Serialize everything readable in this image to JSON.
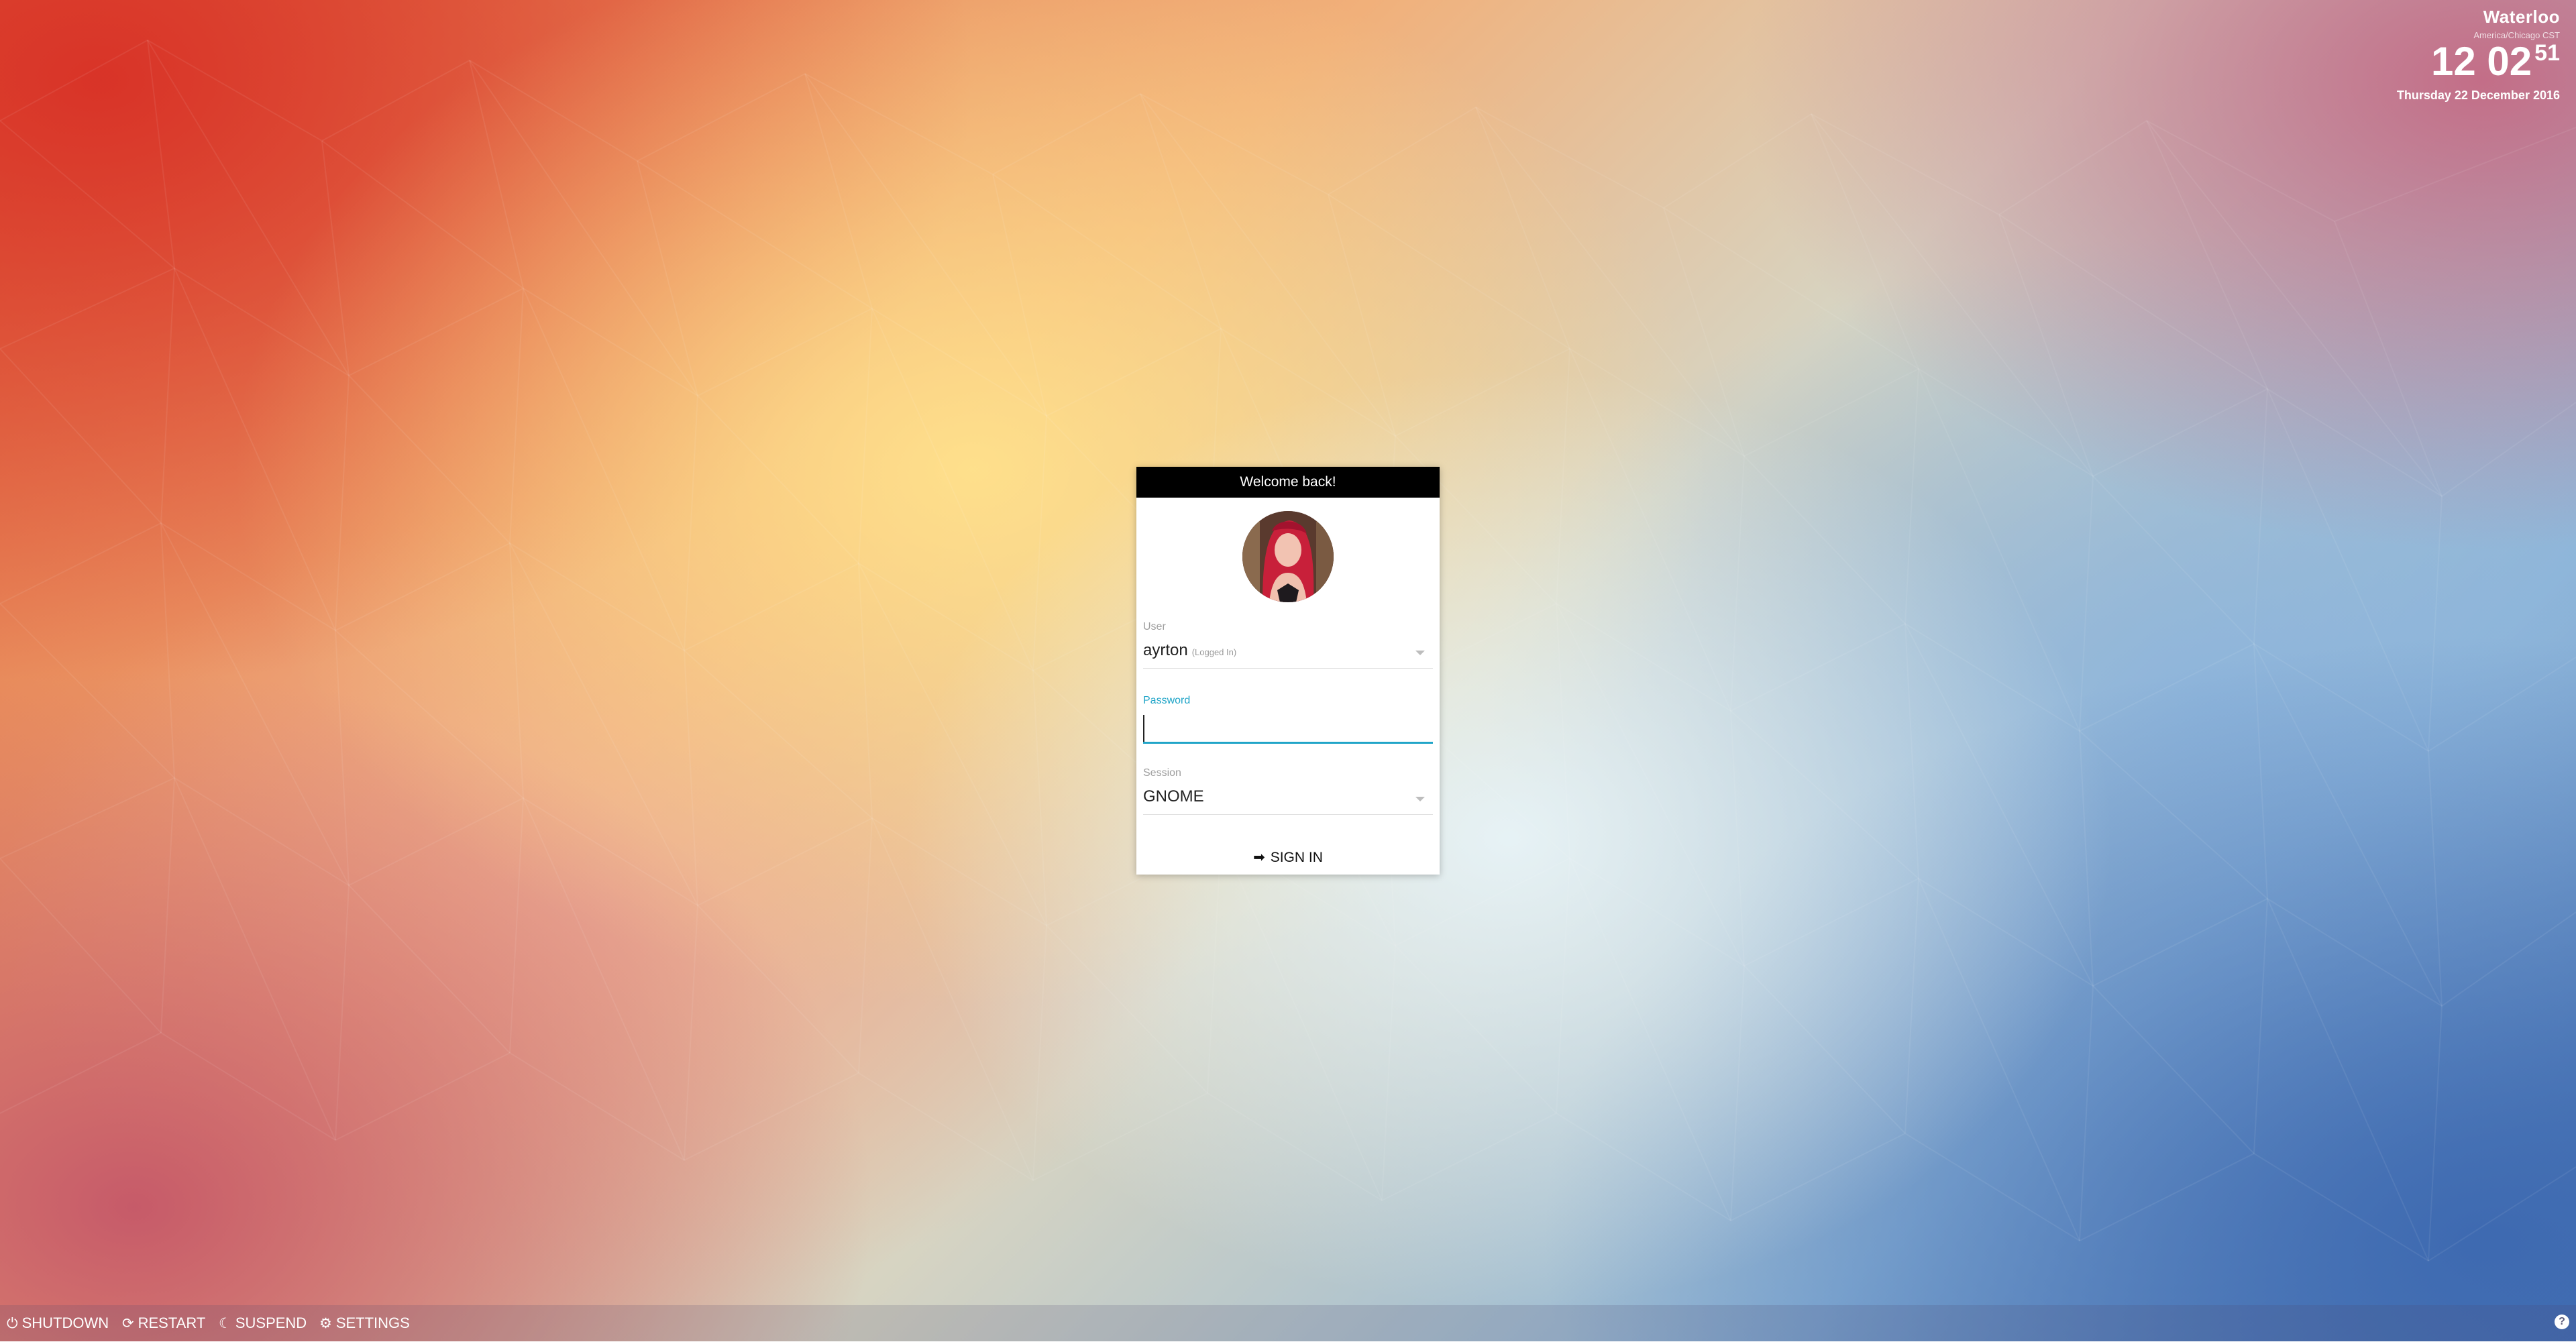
{
  "clock": {
    "city": "Waterloo",
    "timezone": "America/Chicago CST",
    "hours_minutes": "12 02",
    "seconds": "51",
    "date": "Thursday 22 December 2016"
  },
  "login": {
    "header": "Welcome back!",
    "user_label": "User",
    "user_value": "ayrton",
    "user_status": "(Logged In)",
    "password_label": "Password",
    "password_value": "",
    "session_label": "Session",
    "session_value": "GNOME",
    "signin_label": "SIGN IN"
  },
  "bottom_bar": {
    "shutdown_label": "SHUTDOWN",
    "restart_label": "RESTART",
    "suspend_label": "SUSPEND",
    "settings_label": "SETTINGS",
    "help_label": "?"
  },
  "icons": {
    "shutdown": "power-icon",
    "restart": "refresh-icon",
    "suspend": "moon-icon",
    "settings": "gears-icon",
    "signin": "sign-in-icon",
    "help": "question-icon"
  },
  "colors": {
    "accent": "#21a5c8",
    "header_bg": "#000000",
    "card_bg": "#ffffff"
  }
}
